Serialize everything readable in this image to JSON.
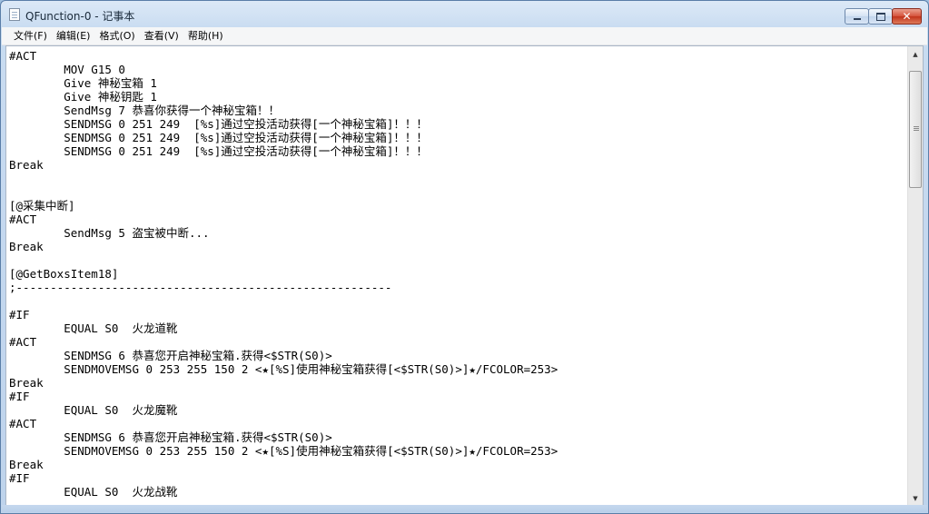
{
  "window": {
    "title": "QFunction-0 - 记事本"
  },
  "menu": {
    "items": [
      {
        "label": "文件(F)"
      },
      {
        "label": "编辑(E)"
      },
      {
        "label": "格式(O)"
      },
      {
        "label": "查看(V)"
      },
      {
        "label": "帮助(H)"
      }
    ]
  },
  "editor": {
    "lines": [
      "#ACT",
      "        MOV G15 0",
      "        Give 神秘宝箱 1",
      "        Give 神秘钥匙 1",
      "        SendMsg 7 恭喜你获得一个神秘宝箱！！",
      "        SENDMSG 0 251 249  [%s]通过空投活动获得[一个神秘宝箱]！！！",
      "        SENDMSG 0 251 249  [%s]通过空投活动获得[一个神秘宝箱]！！！",
      "        SENDMSG 0 251 249  [%s]通过空投活动获得[一个神秘宝箱]！！！",
      "Break",
      "",
      "",
      "[@采集中断]",
      "#ACT",
      "        SendMsg 5 盗宝被中断...",
      "Break",
      "",
      "[@GetBoxsItem18]",
      ";-------------------------------------------------------",
      "",
      "#IF",
      "        EQUAL S0  火龙道靴",
      "#ACT",
      "        SENDMSG 6 恭喜您开启神秘宝箱.获得<$STR(S0)>",
      "        SENDMOVEMSG 0 253 255 150 2 <★[%S]使用神秘宝箱获得[<$STR(S0)>]★/FCOLOR=253>",
      "Break",
      "#IF",
      "        EQUAL S0  火龙魔靴",
      "#ACT",
      "        SENDMSG 6 恭喜您开启神秘宝箱.获得<$STR(S0)>",
      "        SENDMOVEMSG 0 253 255 150 2 <★[%S]使用神秘宝箱获得[<$STR(S0)>]★/FCOLOR=253>",
      "Break",
      "#IF",
      "        EQUAL S0  火龙战靴"
    ]
  },
  "icons": {
    "app": "notepad-icon",
    "minimize": "minimize-icon",
    "maximize": "maximize-icon",
    "close": "close-icon",
    "scroll_up": "scroll-up-arrow-icon",
    "scroll_down": "scroll-down-arrow-icon"
  },
  "colors": {
    "close_button": "#c2331b",
    "title_gradient_top": "#dce9f7",
    "editor_background": "#ffffff"
  }
}
